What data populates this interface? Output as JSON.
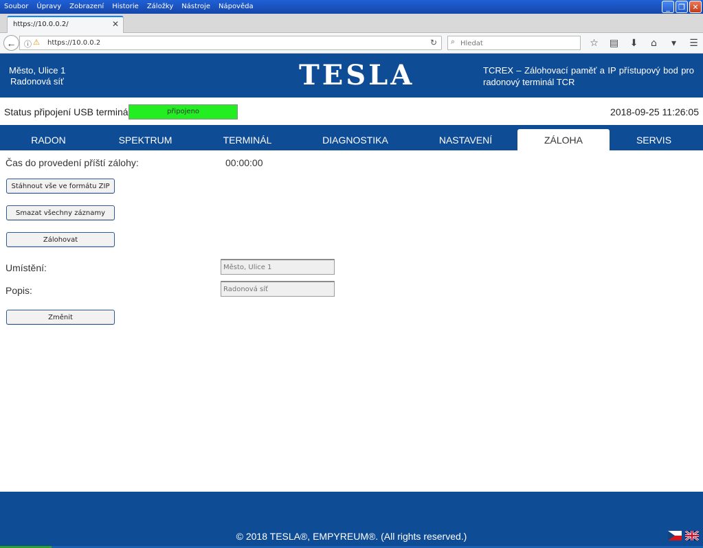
{
  "browser": {
    "menu": [
      "Soubor",
      "Úpravy",
      "Zobrazení",
      "Historie",
      "Záložky",
      "Nástroje",
      "Nápověda"
    ],
    "tab_title": "https://10.0.0.2/",
    "url": "https://10.0.0.2",
    "search_placeholder": "Hledat"
  },
  "header": {
    "location_line1": "Město, Ulice 1",
    "location_line2": "Radonová síť",
    "logo": "TESLA",
    "description": "TCREX – Zálohovací paměť a IP přístupový bod pro radonový terminál TCR"
  },
  "status": {
    "label": "Status připojení USB terminálu:",
    "badge": "připojeno",
    "badge_color": "#22ee22",
    "datetime": "2018-09-25 11:26:05"
  },
  "nav": {
    "tabs": [
      {
        "label": "RADON"
      },
      {
        "label": "SPEKTRUM"
      },
      {
        "label": "TERMINÁL"
      },
      {
        "label": "DIAGNOSTIKA"
      },
      {
        "label": "NASTAVENÍ"
      },
      {
        "label": "ZÁLOHA"
      },
      {
        "label": "SERVIS"
      }
    ],
    "active": "ZÁLOHA"
  },
  "backup": {
    "next_backup_label": "Čas do provedení příští zálohy:",
    "next_backup_value": "00:00:00",
    "download_zip_button": "Stáhnout vše ve formátu ZIP",
    "delete_all_button": "Smazat všechny záznamy",
    "backup_button": "Zálohovat",
    "location_label": "Umístění:",
    "location_placeholder": "Město, Ulice 1",
    "description_label": "Popis:",
    "description_placeholder": "Radonová síť",
    "change_button": "Změnit"
  },
  "footer": {
    "copyright": "© 2018 TESLA®, EMPYREUM®. (All rights reserved.)"
  },
  "colors": {
    "brand_blue": "#0f4c96",
    "status_ok": "#22ee22"
  }
}
